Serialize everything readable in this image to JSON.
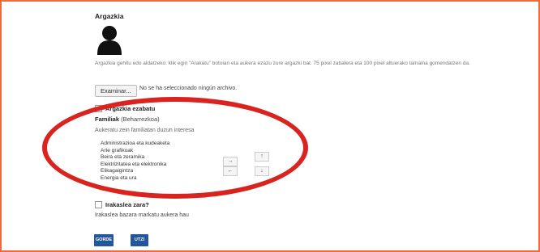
{
  "photo": {
    "heading": "Argazkia",
    "avatar_icon": "user-silhouette-icon",
    "description": "Argazkia gehitu edo aldatzeko: klik egin \"Arakatu\" botoian eta aukera ezazu zure argazki bat. 75 pixel zabalera eta 100 pixel altuerako tamaina gomendatzen da.",
    "browse_label": "Examinar...",
    "no_file_text": "No se ha seleccionado ningún archivo.",
    "delete_label": "Argazkia ezabatu"
  },
  "families": {
    "label": "Familiak",
    "required_text": "(Beharrezkoa)",
    "hint": "Aukeratu zein familiatan duzun interesa",
    "options": [
      "Administrazioa eta kudeaketa",
      "Arte grafikoak",
      "Beira eta zeramika",
      "Elektrizitatea eta elektronika",
      "Elikagaigintza",
      "Energia eta ura"
    ],
    "move_right": "→",
    "move_left": "←",
    "move_up": "↑",
    "move_down": "↓"
  },
  "teacher": {
    "question": "Irakaslea zara?",
    "hint": "Irakaslea bazara markatu aukera hau"
  },
  "actions": {
    "save_label": "GORDE",
    "cancel_label": "UTZI"
  },
  "colors": {
    "frame_border": "#f26a3a",
    "highlight_oval": "#d9231f",
    "primary_button": "#24569b"
  }
}
